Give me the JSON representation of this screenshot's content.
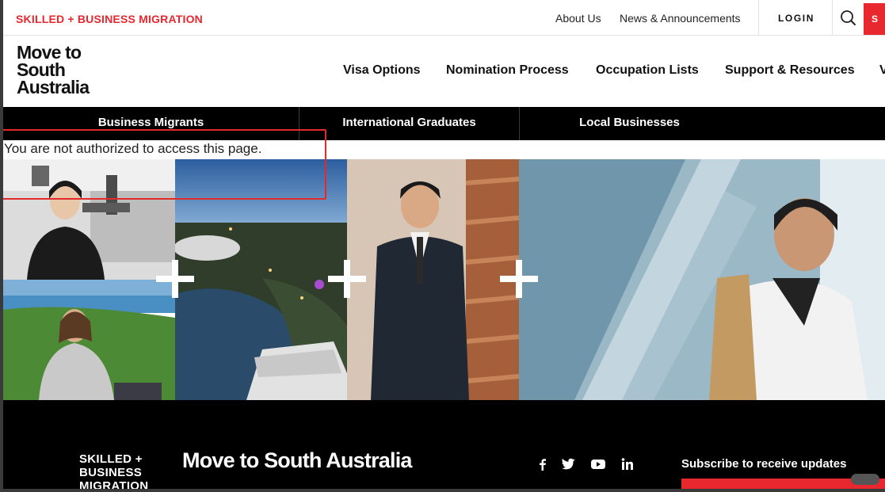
{
  "utility": {
    "brand": "SKILLED + BUSINESS MIGRATION",
    "about": "About Us",
    "news": "News & Announcements",
    "login": "LOGIN",
    "search_icon": "search-icon",
    "red_tab": "S"
  },
  "header": {
    "logo_lines": [
      "Move to",
      "South",
      "Australia"
    ],
    "nav": [
      "Visa Options",
      "Nomination Process",
      "Occupation Lists",
      "Support & Resources",
      "V"
    ]
  },
  "audience_bar": [
    "Business Migrants",
    "International Graduates",
    "Local Businesses"
  ],
  "error_message": "You are not authorized to access this page.",
  "hero": {
    "panels": [
      "optometrist-and-woman-photo",
      "adelaide-aerial-photo",
      "man-in-suit-photo",
      "smiling-man-escalator-photo"
    ],
    "plus_icon": "plus-icon"
  },
  "footer": {
    "brand_lines": [
      "SKILLED +",
      "BUSINESS",
      "MIGRATION"
    ],
    "logo_text": "Move to South Australia",
    "social_icons": [
      "facebook-icon",
      "twitter-icon",
      "youtube-icon",
      "linkedin-icon"
    ],
    "subscribe": "Subscribe to receive updates"
  },
  "colors": {
    "accent": "#e8282e",
    "bar": "#000000",
    "highlight_box": "#e22a2a"
  }
}
